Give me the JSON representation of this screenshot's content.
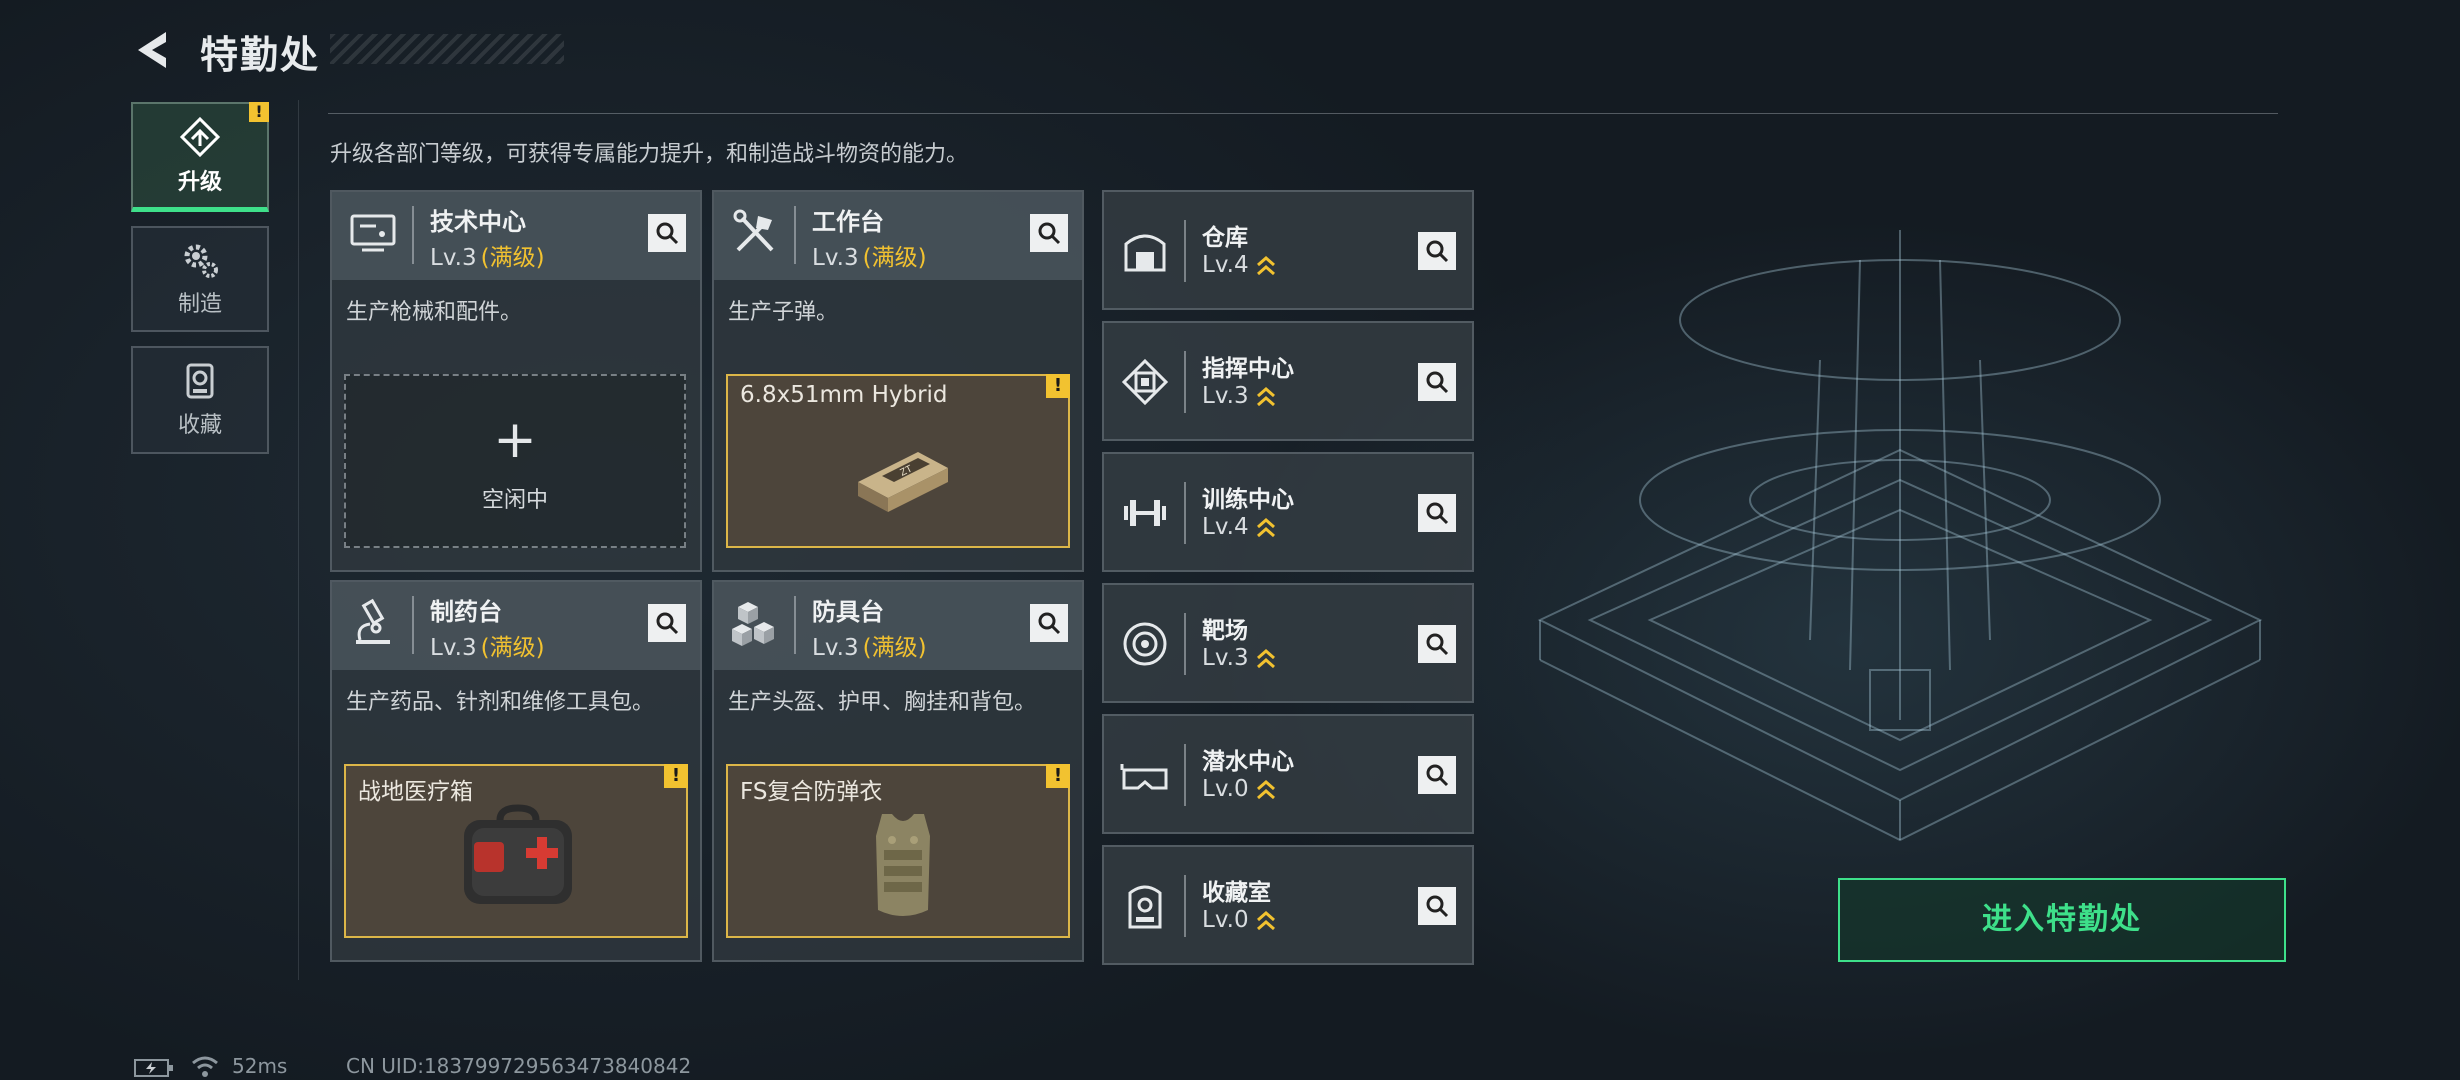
{
  "header": {
    "title": "特勤处"
  },
  "nav": [
    {
      "label": "升级",
      "active": true,
      "warning": "!"
    },
    {
      "label": "制造",
      "active": false
    },
    {
      "label": "收藏",
      "active": false
    }
  ],
  "description": "升级各部门等级，可获得专属能力提升，和制造战斗物资的能力。",
  "cards": [
    {
      "name": "技术中心",
      "level": "Lv.3",
      "max": "(满级)",
      "desc": "生产枪械和配件。",
      "slot": {
        "type": "empty",
        "plus": "+",
        "text": "空闲中"
      }
    },
    {
      "name": "工作台",
      "level": "Lv.3",
      "max": "(满级)",
      "desc": "生产子弹。",
      "slot": {
        "type": "item",
        "name": "6.8x51mm Hybrid",
        "warning": "!"
      }
    },
    {
      "name": "制药台",
      "level": "Lv.3",
      "max": "(满级)",
      "desc": "生产药品、针剂和维修工具包。",
      "slot": {
        "type": "item",
        "name": "战地医疗箱",
        "warning": "!"
      }
    },
    {
      "name": "防具台",
      "level": "Lv.3",
      "max": "(满级)",
      "desc": "生产头盔、护甲、胸挂和背包。",
      "slot": {
        "type": "item",
        "name": "FS复合防弹衣",
        "warning": "!"
      }
    }
  ],
  "facilities": [
    {
      "name": "仓库",
      "level": "Lv.4",
      "icon": "warehouse-icon"
    },
    {
      "name": "指挥中心",
      "level": "Lv.3",
      "icon": "chip-icon"
    },
    {
      "name": "训练中心",
      "level": "Lv.4",
      "icon": "dumbbell-icon"
    },
    {
      "name": "靶场",
      "level": "Lv.3",
      "icon": "target-icon"
    },
    {
      "name": "潜水中心",
      "level": "Lv.0",
      "icon": "goggles-icon"
    },
    {
      "name": "收藏室",
      "level": "Lv.0",
      "icon": "showcase-icon"
    }
  ],
  "enter_button": "进入特勤处",
  "footer": {
    "ping": "52ms",
    "uid": "CN UID:183799729563473840842"
  },
  "colors": {
    "accent_green": "#3ee08a",
    "warning_yellow": "#f2c230",
    "max_level": "#f2c230"
  }
}
